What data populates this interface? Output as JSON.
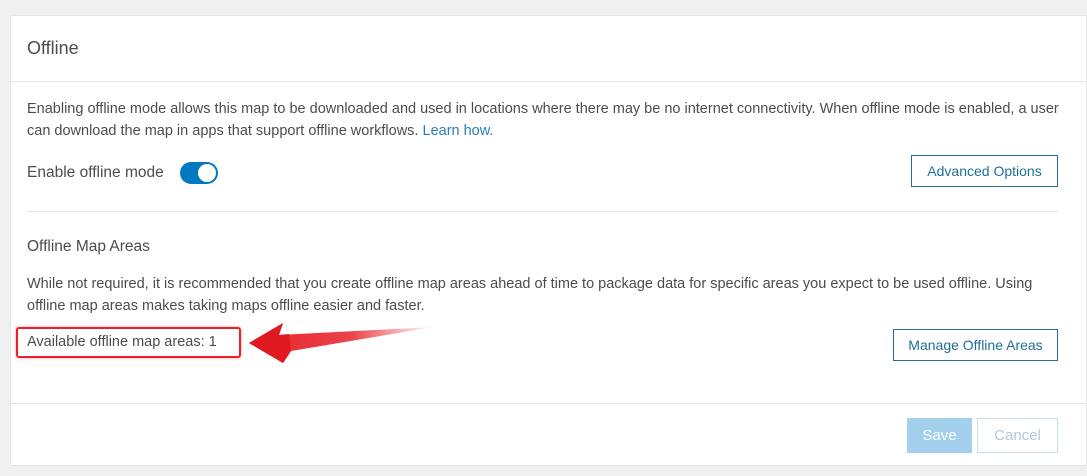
{
  "panel": {
    "title": "Offline"
  },
  "offline_mode": {
    "description": "Enabling offline mode allows this map to be downloaded and used in locations where there may be no internet connectivity. When offline mode is enabled, a user can download the map in apps that support offline workflows.",
    "learn_link": "Learn how.",
    "toggle_label": "Enable offline mode",
    "toggle_on": true,
    "advanced_button": "Advanced Options"
  },
  "map_areas": {
    "title": "Offline Map Areas",
    "description": "While not required, it is recommended that you create offline map areas ahead of time to package data for specific areas you expect to be used offline. Using offline map areas makes taking maps offline easier and faster.",
    "available_label": "Available offline map areas: 1",
    "manage_button": "Manage Offline Areas"
  },
  "footer": {
    "save_label": "Save",
    "cancel_label": "Cancel"
  },
  "colors": {
    "accent": "#0079c1",
    "link": "#2b7fb8",
    "annotation": "#e8212a",
    "save_disabled": "#a3d0ed"
  }
}
